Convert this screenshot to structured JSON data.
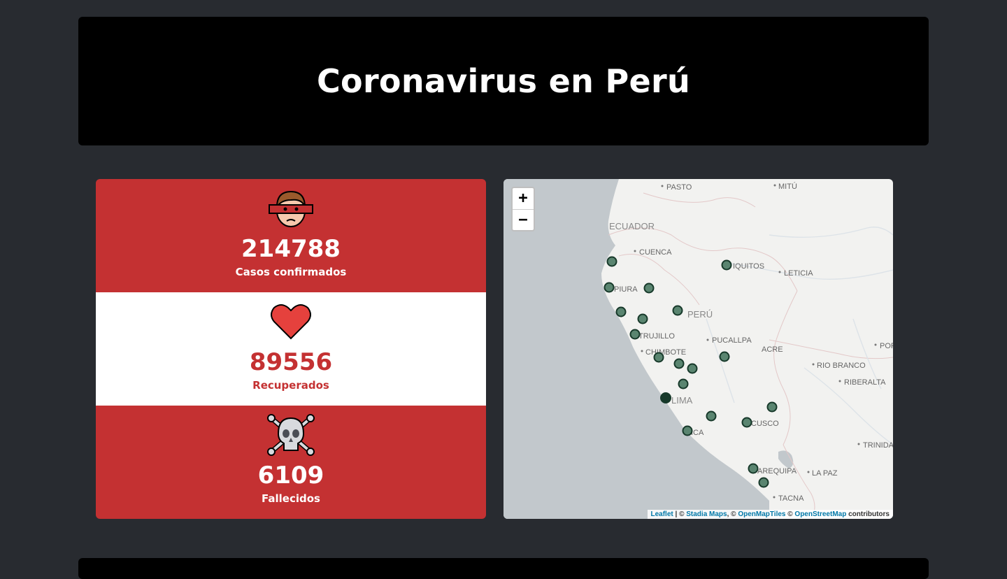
{
  "header": {
    "title": "Coronavirus en Perú"
  },
  "stats": {
    "confirmed": {
      "value": "214788",
      "label": "Casos confirmados",
      "icon": "masked-face-icon"
    },
    "recovered": {
      "value": "89556",
      "label": "Recuperados",
      "icon": "heart-icon"
    },
    "deaths": {
      "value": "6109",
      "label": "Fallecidos",
      "icon": "skull-crossbones-icon"
    }
  },
  "colors": {
    "red": "#c43132",
    "page_bg": "#282b30",
    "header_bg": "#000000",
    "marker": "#4e7a63"
  },
  "map": {
    "zoom_in": "+",
    "zoom_out": "−",
    "labels": {
      "pasto": "PASTO",
      "mitu": "MITÚ",
      "ecuador": "ECUADOR",
      "cuenca": "CUENCA",
      "iquitos": "IQUITOS",
      "leticia": "LETICIA",
      "piura": "PIURA",
      "peru": "PERÚ",
      "trujillo": "TRUJILLO",
      "pucallpa": "PUCALLPA",
      "chimbote": "CHIMBOTE",
      "acre": "ACRE",
      "porto": "POR",
      "rio_branco": "RIO BRANCO",
      "riberalta": "RIBERALTA",
      "lima": "LIMA",
      "cusco": "CUSCO",
      "ica": "ICA",
      "trinidad": "TRINIDA",
      "arequipa": "AREQUIPA",
      "la_paz": "LA PAZ",
      "tacna": "TACNA"
    },
    "attribution": {
      "leaflet": "Leaflet",
      "sep1": " | © ",
      "stadia": "Stadia Maps",
      "sep2": ", © ",
      "omt": "OpenMapTiles",
      "sep3": " © ",
      "osm": "OpenStreetMap",
      "tail": " contributors"
    }
  }
}
